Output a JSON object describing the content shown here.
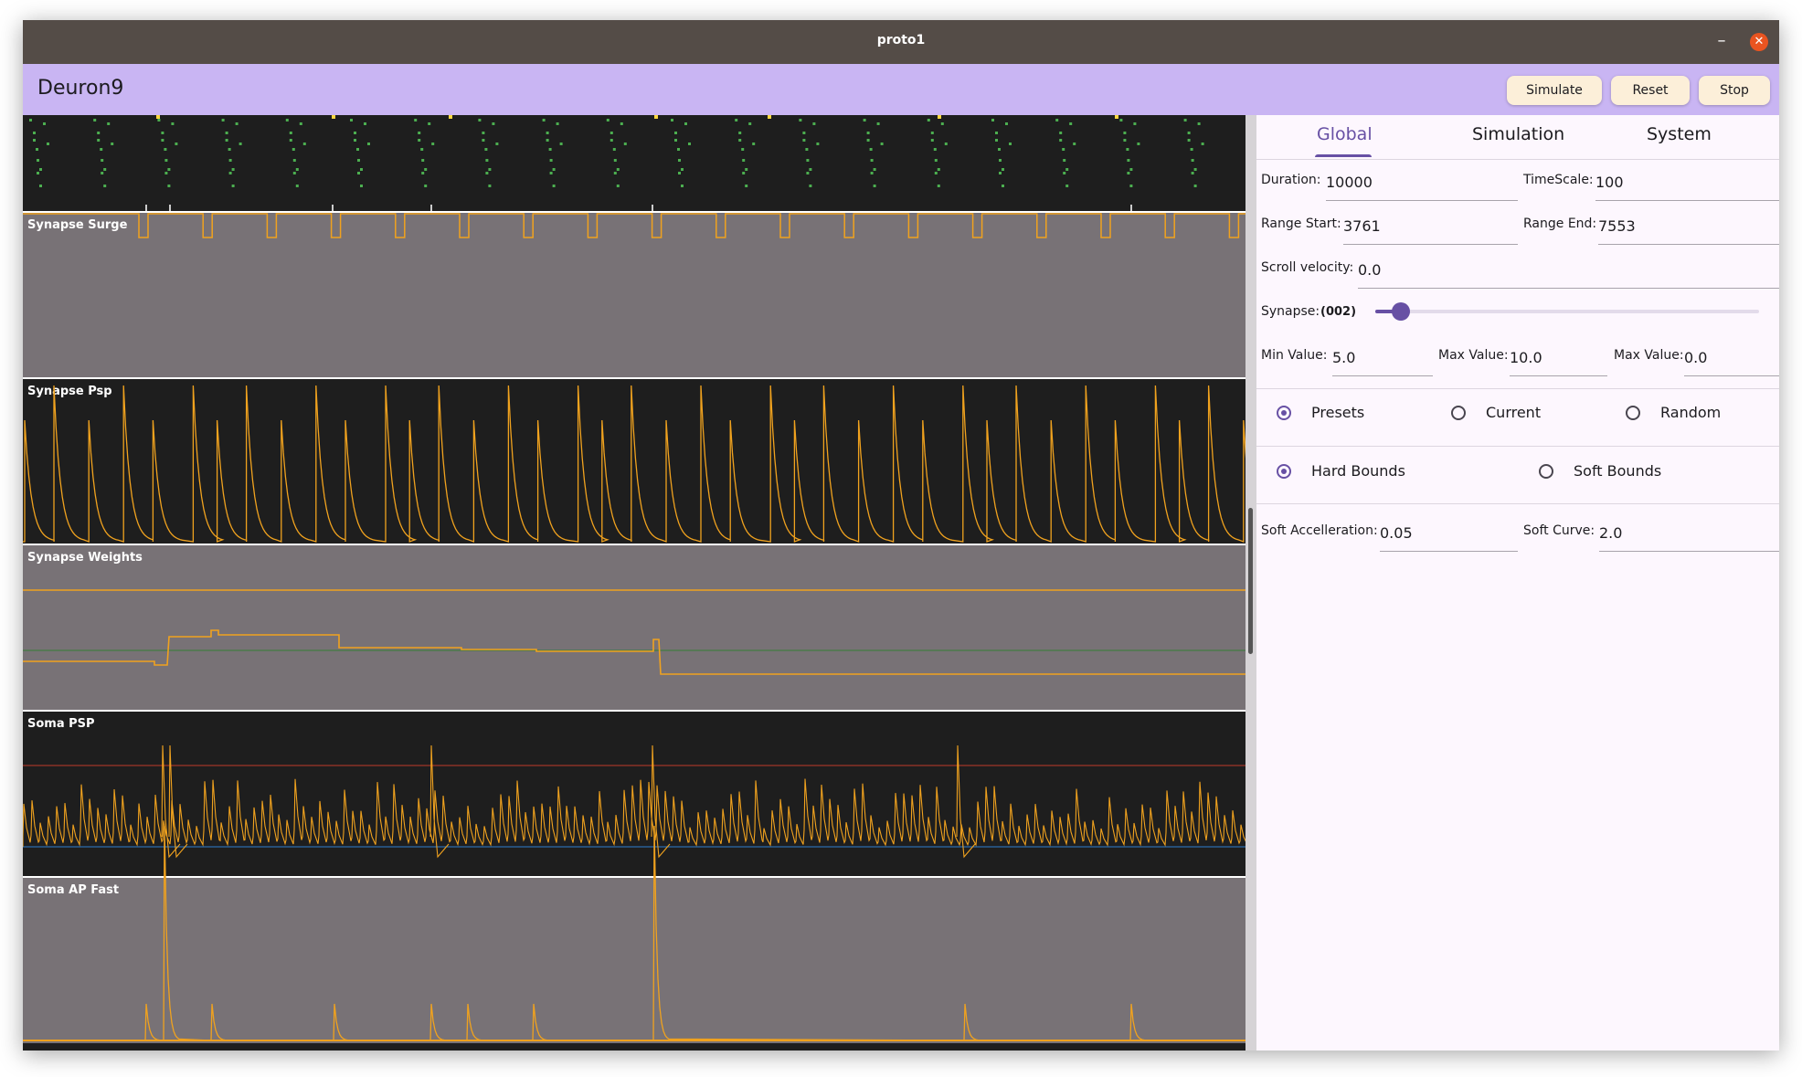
{
  "window": {
    "title": "proto1",
    "minimize_glyph": "–",
    "close_glyph": "✕"
  },
  "appbar": {
    "title": "Deuron9",
    "buttons": [
      "Simulate",
      "Reset",
      "Stop"
    ]
  },
  "plots": {
    "labels": [
      "Synapse Surge",
      "Synapse Psp",
      "Synapse Weights",
      "Soma PSP",
      "Soma AP Fast"
    ],
    "colors": {
      "trace": "#f0a21e",
      "dark_bg": "#1e1e1e",
      "grey_bg": "#787276",
      "spike_green": "#4caf50",
      "spike_yellow": "#ffd740",
      "weights_green_line": "#4a7a4a",
      "soma_threshold": "#c0392b",
      "soma_rest": "#2f7fd0"
    }
  },
  "tabs": [
    "Global",
    "Simulation",
    "System"
  ],
  "global": {
    "duration": {
      "label": "Duration:",
      "value": "10000"
    },
    "timescale": {
      "label": "TimeScale:",
      "value": "100"
    },
    "range_start": {
      "label": "Range Start:",
      "value": "3761"
    },
    "range_end": {
      "label": "Range End:",
      "value": "7553"
    },
    "scroll_velocity": {
      "label": "Scroll velocity:",
      "value": "0.0"
    },
    "synapse": {
      "label": "Synapse:",
      "value": "(002)",
      "slider_fraction": 0.05
    },
    "min_value": {
      "label": "Min Value:",
      "value": "5.0"
    },
    "max_value_1": {
      "label": "Max Value:",
      "value": "10.0"
    },
    "max_value_2": {
      "label": "Max Value:",
      "value": "0.0"
    },
    "source_radios": [
      "Presets",
      "Current",
      "Random"
    ],
    "source_selected": "Presets",
    "bounds_radios": [
      "Hard Bounds",
      "Soft Bounds"
    ],
    "bounds_selected": "Hard Bounds",
    "soft_acceleration": {
      "label": "Soft Accelleration:",
      "value": "0.05"
    },
    "soft_curve": {
      "label": "Soft Curve:",
      "value": "2.0"
    }
  },
  "accent": "#6750a4"
}
